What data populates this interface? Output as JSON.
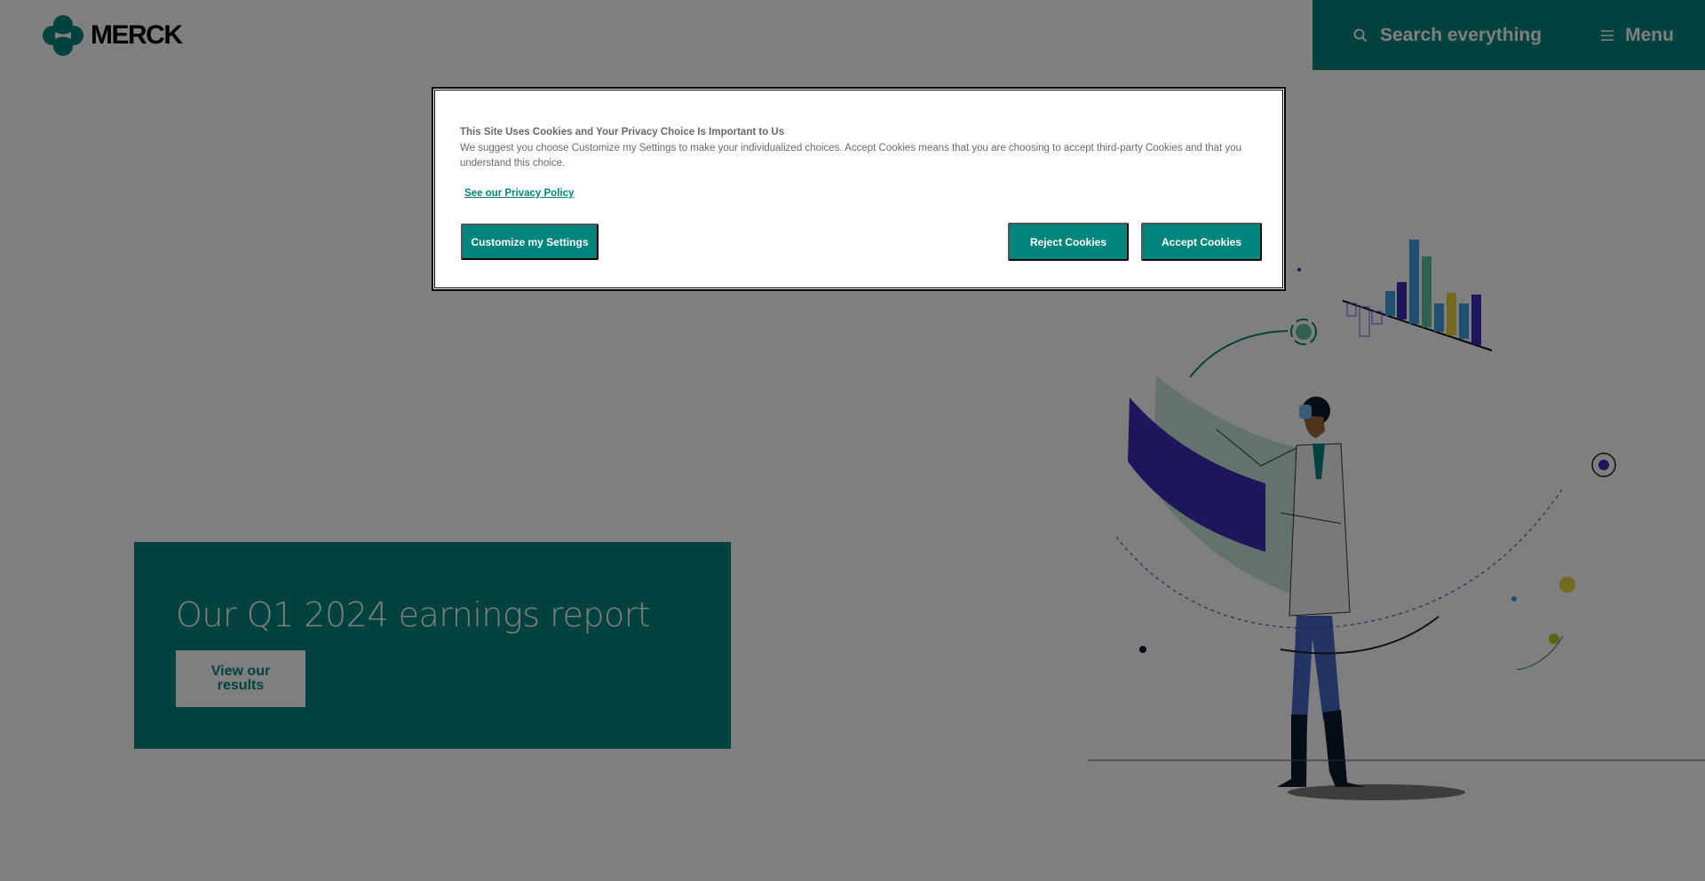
{
  "header": {
    "logo_text": "MERCK",
    "search_label": "Search everything",
    "menu_label": "Menu"
  },
  "promo": {
    "title": "Our Q1 2024 earnings report",
    "button_label": "View our results"
  },
  "cookie_dialog": {
    "title": "This Site Uses Cookies and Your Privacy Choice Is Important to Us",
    "description": "We suggest you choose Customize my Settings to make your individualized choices. Accept Cookies means that you are choosing to accept third-party Cookies and that you understand this choice.",
    "policy_link": "See our Privacy Policy",
    "customize_label": "Customize my Settings",
    "reject_label": "Reject Cookies",
    "accept_label": "Accept Cookies"
  },
  "colors": {
    "brand_teal": "#00857c",
    "overlay": "rgba(0,0,0,0.5)"
  },
  "icons": {
    "search": "search-icon",
    "menu": "hamburger-menu-icon",
    "logo": "merck-logo-icon"
  }
}
